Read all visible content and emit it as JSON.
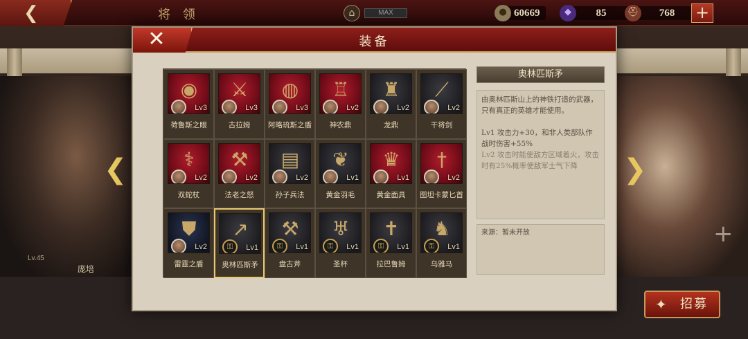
{
  "topbar": {
    "title": "将 领",
    "rank_label": "MAX",
    "gold": "60669",
    "gems": "85",
    "helmets": "768",
    "plus": "+",
    "back_icon": "arrow-left-icon"
  },
  "hero": {
    "left_level": "Lv.45",
    "left_name": "庞培",
    "right_plus": "+"
  },
  "recruit_label": "招募",
  "modal": {
    "title": "装备",
    "close": "✕"
  },
  "items": [
    {
      "name": "荷鲁斯之眼",
      "level": "Lv3",
      "bg": "red",
      "glyph": "◉",
      "locked": false
    },
    {
      "name": "古拉姆",
      "level": "Lv3",
      "bg": "red",
      "glyph": "⚔",
      "locked": false
    },
    {
      "name": "阿略琉斯之盾",
      "level": "Lv3",
      "bg": "red",
      "glyph": "◍",
      "locked": false
    },
    {
      "name": "神农鼎",
      "level": "Lv2",
      "bg": "red",
      "glyph": "♖",
      "locked": false
    },
    {
      "name": "龙鼎",
      "level": "Lv2",
      "bg": "dark",
      "glyph": "♜",
      "locked": false
    },
    {
      "name": "干将剑",
      "level": "Lv2",
      "bg": "dark",
      "glyph": "⟋",
      "locked": false
    },
    {
      "name": "双蛇杖",
      "level": "Lv2",
      "bg": "red",
      "glyph": "⚕",
      "locked": false
    },
    {
      "name": "法老之怒",
      "level": "Lv2",
      "bg": "red",
      "glyph": "⚒",
      "locked": false
    },
    {
      "name": "孙子兵法",
      "level": "Lv2",
      "bg": "dark",
      "glyph": "▤",
      "locked": false
    },
    {
      "name": "黄金羽毛",
      "level": "Lv1",
      "bg": "dark",
      "glyph": "❦",
      "locked": false
    },
    {
      "name": "黄金面具",
      "level": "Lv1",
      "bg": "red",
      "glyph": "♛",
      "locked": false
    },
    {
      "name": "图坦卡蒙匕首",
      "level": "Lv2",
      "bg": "red",
      "glyph": "†",
      "locked": false
    },
    {
      "name": "雷霆之盾",
      "level": "Lv2",
      "bg": "navy",
      "glyph": "⛊",
      "locked": false
    },
    {
      "name": "奥林匹斯矛",
      "level": "Lv1",
      "bg": "dark",
      "glyph": "↗",
      "locked": true
    },
    {
      "name": "盘古斧",
      "level": "Lv1",
      "bg": "dark",
      "glyph": "⚒",
      "locked": true
    },
    {
      "name": "圣杯",
      "level": "Lv1",
      "bg": "dark",
      "glyph": "♅",
      "locked": true
    },
    {
      "name": "拉巴鲁姆",
      "level": "Lv1",
      "bg": "dark",
      "glyph": "✝",
      "locked": true
    },
    {
      "name": "乌雅马",
      "level": "Lv1",
      "bg": "dark",
      "glyph": "♞",
      "locked": true
    }
  ],
  "detail": {
    "title": "奥林匹斯矛",
    "description": "由奥林匹斯山上的神铁打造的武器，只有真正的英雄才能使用。",
    "lv1": "Lv1  攻击力+30，和非人类部队作战时伤害+55%",
    "lv2": "Lv2  攻击时能使敌方区域着火，攻击时有25%概率使敌军士气下降",
    "source": "来源：暂未开放"
  }
}
